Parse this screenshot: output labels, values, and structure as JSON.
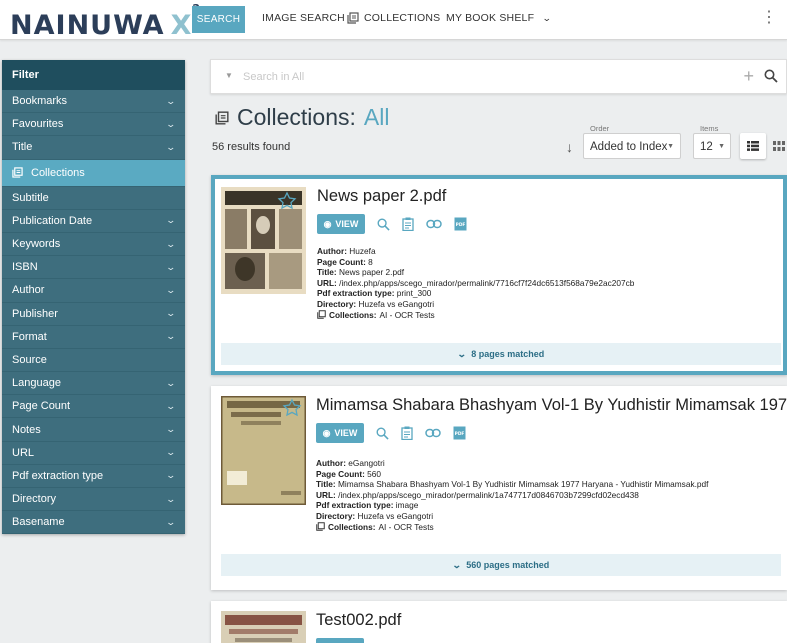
{
  "brand": {
    "name_pre": "N",
    "name_ai": "AI",
    "name_post": "NUWA",
    "name_x": "X",
    "superscript": "2"
  },
  "nav": {
    "search": "SEARCH",
    "image_search": "IMAGE SEARCH",
    "collections": "COLLECTIONS",
    "my_book_shelf": "MY BOOK SHELF"
  },
  "sidebar": {
    "heading": "Filter",
    "items": [
      {
        "label": "Bookmarks",
        "expandable": true
      },
      {
        "label": "Favourites",
        "expandable": true
      },
      {
        "label": "Title",
        "expandable": true
      },
      {
        "label": "Collections",
        "expandable": false,
        "active": true
      },
      {
        "label": "Subtitle",
        "expandable": false
      },
      {
        "label": "Publication Date",
        "expandable": true
      },
      {
        "label": "Keywords",
        "expandable": true
      },
      {
        "label": "ISBN",
        "expandable": true
      },
      {
        "label": "Author",
        "expandable": true
      },
      {
        "label": "Publisher",
        "expandable": true
      },
      {
        "label": "Format",
        "expandable": true
      },
      {
        "label": "Source",
        "expandable": false
      },
      {
        "label": "Language",
        "expandable": true
      },
      {
        "label": "Page Count",
        "expandable": true
      },
      {
        "label": "Notes",
        "expandable": true
      },
      {
        "label": "URL",
        "expandable": true
      },
      {
        "label": "Pdf extraction type",
        "expandable": true
      },
      {
        "label": "Directory",
        "expandable": true
      },
      {
        "label": "Basename",
        "expandable": true
      }
    ]
  },
  "search": {
    "placeholder": "Search in All"
  },
  "page": {
    "title_prefix": "Collections:",
    "title_value": "All",
    "results": "56 results found"
  },
  "sort": {
    "order_label": "Order",
    "order_value": "Added to Index",
    "items_label": "Items",
    "items_value": "12"
  },
  "meta_labels": {
    "author": "Author:",
    "page_count": "Page Count:",
    "title": "Title:",
    "url": "URL:",
    "pdf_type": "Pdf extraction type:",
    "directory": "Directory:",
    "collections": "Collections:"
  },
  "view_label": "VIEW",
  "results": [
    {
      "title": "News paper 2.pdf",
      "author": "Huzefa",
      "page_count": "8",
      "full_title": "News paper 2.pdf",
      "url": "/index.php/apps/scego_mirador/permalink/7716cf7f24dc6513f568a79e2ac207cb",
      "pdf_type": "print_300",
      "directory": "Huzefa vs eGangotri",
      "collections": "AI - OCR Tests",
      "matched": "8 pages matched"
    },
    {
      "title": "Mimamsa Shabara Bhashyam Vol-1 By Yudhistir Mimamsak 197…",
      "author": "eGangotri",
      "page_count": "560",
      "full_title": "Mimamsa Shabara Bhashyam Vol-1 By Yudhistir Mimamsak 1977 Haryana - Yudhistir Mimamsak.pdf",
      "url": "/index.php/apps/scego_mirador/permalink/1a747717d0846703b7299cfd02ecd438",
      "pdf_type": "image",
      "directory": "Huzefa vs eGangotri",
      "collections": "AI - OCR Tests",
      "matched": "560 pages matched"
    },
    {
      "title": "Test002.pdf"
    }
  ],
  "colors": {
    "accent": "#59a7c0",
    "sidebar": "#3e6e7e",
    "sidebar_head": "#1f4e5e",
    "brand": "#2c3e59"
  }
}
